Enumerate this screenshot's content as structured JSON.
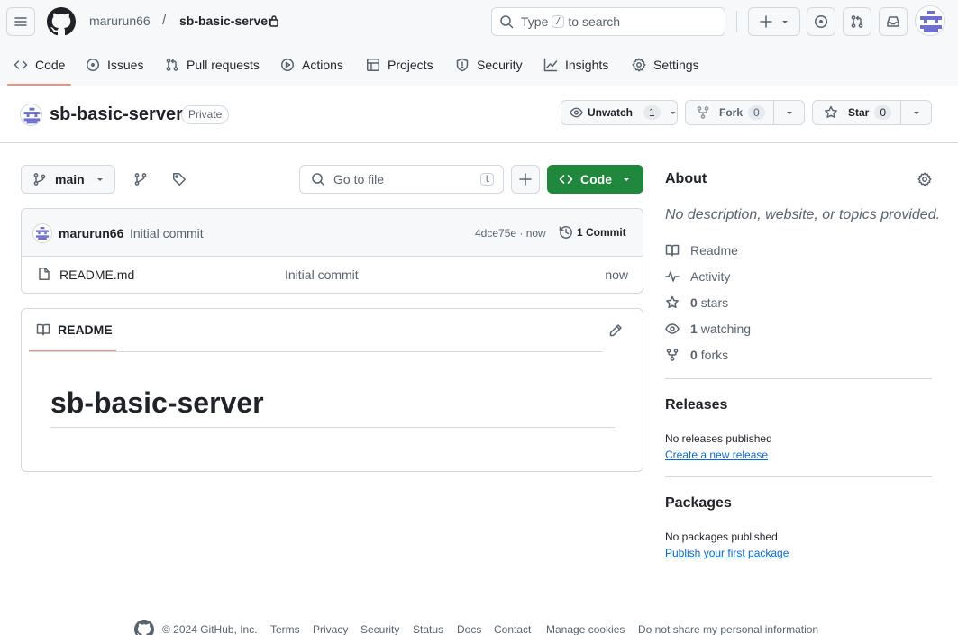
{
  "header": {
    "owner": "marurun66",
    "separator": "/",
    "repo": "sb-basic-server",
    "search": {
      "prefix": "Type",
      "key": "/",
      "suffix": "to search"
    }
  },
  "tabs": [
    {
      "label": "Code",
      "icon": "code-icon",
      "selected": true
    },
    {
      "label": "Issues",
      "icon": "issue-icon"
    },
    {
      "label": "Pull requests",
      "icon": "pull-request-icon"
    },
    {
      "label": "Actions",
      "icon": "play-icon"
    },
    {
      "label": "Projects",
      "icon": "table-icon"
    },
    {
      "label": "Security",
      "icon": "shield-icon"
    },
    {
      "label": "Insights",
      "icon": "graph-icon"
    },
    {
      "label": "Settings",
      "icon": "gear-icon"
    }
  ],
  "repo_header": {
    "name": "sb-basic-server",
    "visibility": "Private",
    "unwatch_label": "Unwatch",
    "watch_count": "1",
    "fork_label": "Fork",
    "fork_count": "0",
    "star_label": "Star",
    "star_count": "0"
  },
  "toolbar": {
    "branch": "main",
    "go_to_file_placeholder": "Go to file",
    "go_to_file_key": "t",
    "code_label": "Code"
  },
  "commit": {
    "author": "marurun66",
    "message": "Initial commit",
    "sha_time": "4dce75e · now",
    "commits_label": "1 Commit"
  },
  "files": [
    {
      "name": "README.md",
      "message": "Initial commit",
      "time": "now",
      "icon": "file-icon"
    }
  ],
  "readme": {
    "tab_label": "README",
    "heading": "sb-basic-server"
  },
  "about": {
    "title": "About",
    "description": "No description, website, or topics provided.",
    "items": [
      {
        "icon": "book-icon",
        "label": "Readme"
      },
      {
        "icon": "pulse-icon",
        "label": "Activity"
      },
      {
        "icon": "star-icon",
        "count": "0",
        "label": "stars"
      },
      {
        "icon": "eye-icon",
        "count": "1",
        "label": "watching"
      },
      {
        "icon": "fork-icon",
        "count": "0",
        "label": "forks"
      }
    ]
  },
  "releases": {
    "title": "Releases",
    "empty": "No releases published",
    "link": "Create a new release"
  },
  "packages": {
    "title": "Packages",
    "empty": "No packages published",
    "link": "Publish your first package"
  },
  "footer": {
    "copyright": "© 2024 GitHub, Inc.",
    "links": [
      "Terms",
      "Privacy",
      "Security",
      "Status",
      "Docs",
      "Contact",
      "Manage cookies",
      "Do not share my personal information"
    ]
  },
  "colors": {
    "accent_green": "#1f883d",
    "link_blue": "#0969da",
    "tab_underline": "#fd8c73",
    "avatar_purple": "#6e6fd1"
  }
}
